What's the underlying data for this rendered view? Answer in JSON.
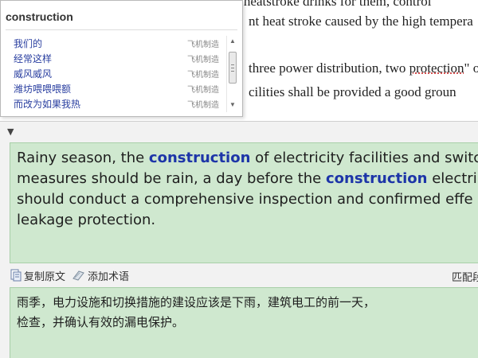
{
  "document": {
    "lines": [
      "construction employees to be work, ready to heatstroke drinks for them, control",
      "nt heat stroke caused by the high tempera",
      "three power distribution, two ",
      "cilities shall be provided a good groun"
    ],
    "underlined_word": "protection",
    "line3_tail": "\" o"
  },
  "popup": {
    "query": "construction",
    "suggestions": [
      {
        "text": "我们的",
        "source": "飞机制造"
      },
      {
        "text": "经常这样",
        "source": "飞机制造"
      },
      {
        "text": "威风威风",
        "source": "飞机制造"
      },
      {
        "text": "潍坊喂喂喂额",
        "source": "飞机制造"
      },
      {
        "text": "而改为如果我热",
        "source": "飞机制造"
      }
    ]
  },
  "panel": {
    "collapse_icon": "triangle-down",
    "source": {
      "line1": {
        "pre": "Rainy season, the ",
        "term": "construction",
        "post": " of electricity facilities and switc"
      },
      "line2": {
        "pre": "measures should be rain, a day before the ",
        "term": "construction",
        "post": " electri"
      },
      "line3": "should conduct a comprehensive inspection and confirmed effe",
      "line4": "leakage protection."
    },
    "toolbar": {
      "copy_label": "复制原文",
      "add_term_label": "添加术语",
      "align_label": "匹配段"
    },
    "target": {
      "line1": "雨季，电力设施和切换措施的建设应该是下雨，建筑电工的前一天，",
      "line2": "检查，并确认有效的漏电保护。"
    }
  },
  "colors": {
    "highlight_term": "#1d35a8",
    "panel_green": "#cfe8cf",
    "suggestion_text": "#2a3fa0"
  }
}
